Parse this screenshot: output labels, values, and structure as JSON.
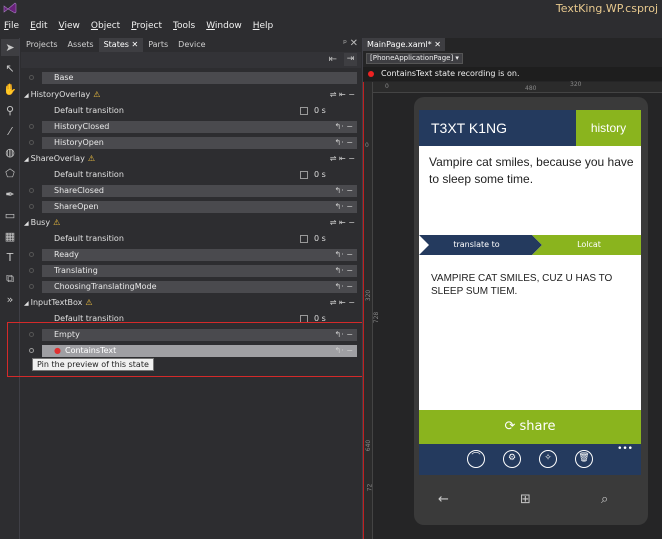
{
  "window": {
    "title": "TextKing.WP.csproj"
  },
  "menu": [
    {
      "label": "File",
      "u": "F",
      "rest": "ile"
    },
    {
      "label": "Edit",
      "u": "E",
      "rest": "dit"
    },
    {
      "label": "View",
      "u": "V",
      "rest": "iew"
    },
    {
      "label": "Object",
      "u": "O",
      "rest": "bject"
    },
    {
      "label": "Project",
      "u": "P",
      "rest": "roject"
    },
    {
      "label": "Tools",
      "u": "T",
      "rest": "ools"
    },
    {
      "label": "Window",
      "u": "W",
      "rest": "indow"
    },
    {
      "label": "Help",
      "u": "H",
      "rest": "elp"
    }
  ],
  "panel": {
    "tabs": [
      "Projects",
      "Assets",
      "States ✕",
      "Parts",
      "Device"
    ],
    "pin": "ᵖ",
    "close": "✕"
  },
  "states": {
    "base": "Base",
    "groups": [
      {
        "name": "HistoryOverlay",
        "transition": "Default transition",
        "duration": "0 s",
        "states": [
          "HistoryClosed",
          "HistoryOpen"
        ]
      },
      {
        "name": "ShareOverlay",
        "transition": "Default transition",
        "duration": "0 s",
        "states": [
          "ShareClosed",
          "ShareOpen"
        ]
      },
      {
        "name": "Busy",
        "transition": "Default transition",
        "duration": "0 s",
        "states": [
          "Ready",
          "Translating",
          "ChoosingTranslatingMode"
        ]
      },
      {
        "name": "InputTextBox",
        "transition": "Default transition",
        "duration": "0 s",
        "states": [
          "Empty",
          "ContainsText"
        ]
      }
    ],
    "selected_state": "ContainsText",
    "tooltip": "Pin the preview of this state"
  },
  "document": {
    "tab": "MainPage.xaml*",
    "tab_close": "✕",
    "breadcrumb": "[PhoneApplicationPage] ▾",
    "recording_text": "ContainsText state recording is on.",
    "ruler_top": [
      "0",
      "480",
      "320"
    ],
    "ruler_left": [
      "0",
      "320",
      "728",
      "640",
      "72"
    ]
  },
  "app": {
    "title": "T3XT K1NG",
    "history_button": "history",
    "input_text": "Vampire cat smiles, because you have to sleep some time.",
    "translate_to": "translate to",
    "language": "Lolcat",
    "output_text": "VAMPIRE CAT SMILES, CUZ U HAS TO SLEEP SUM TIEM.",
    "share_label": "share",
    "colors": {
      "navy": "#243a5e",
      "green": "#8ab41e"
    },
    "appbar_icons": [
      "translate-icon",
      "settings-icon",
      "magic-icon",
      "delete-icon"
    ],
    "appbar_icon_glyphs": [
      "⌒",
      "⚙",
      "✧",
      "🗑"
    ],
    "appbar_more": "•••",
    "nav": {
      "back": "←",
      "home": "⊞",
      "search": "⌕"
    }
  },
  "ui_glyphs": {
    "warn": "⚠",
    "expand": "◢",
    "share_icon": "⟳"
  }
}
